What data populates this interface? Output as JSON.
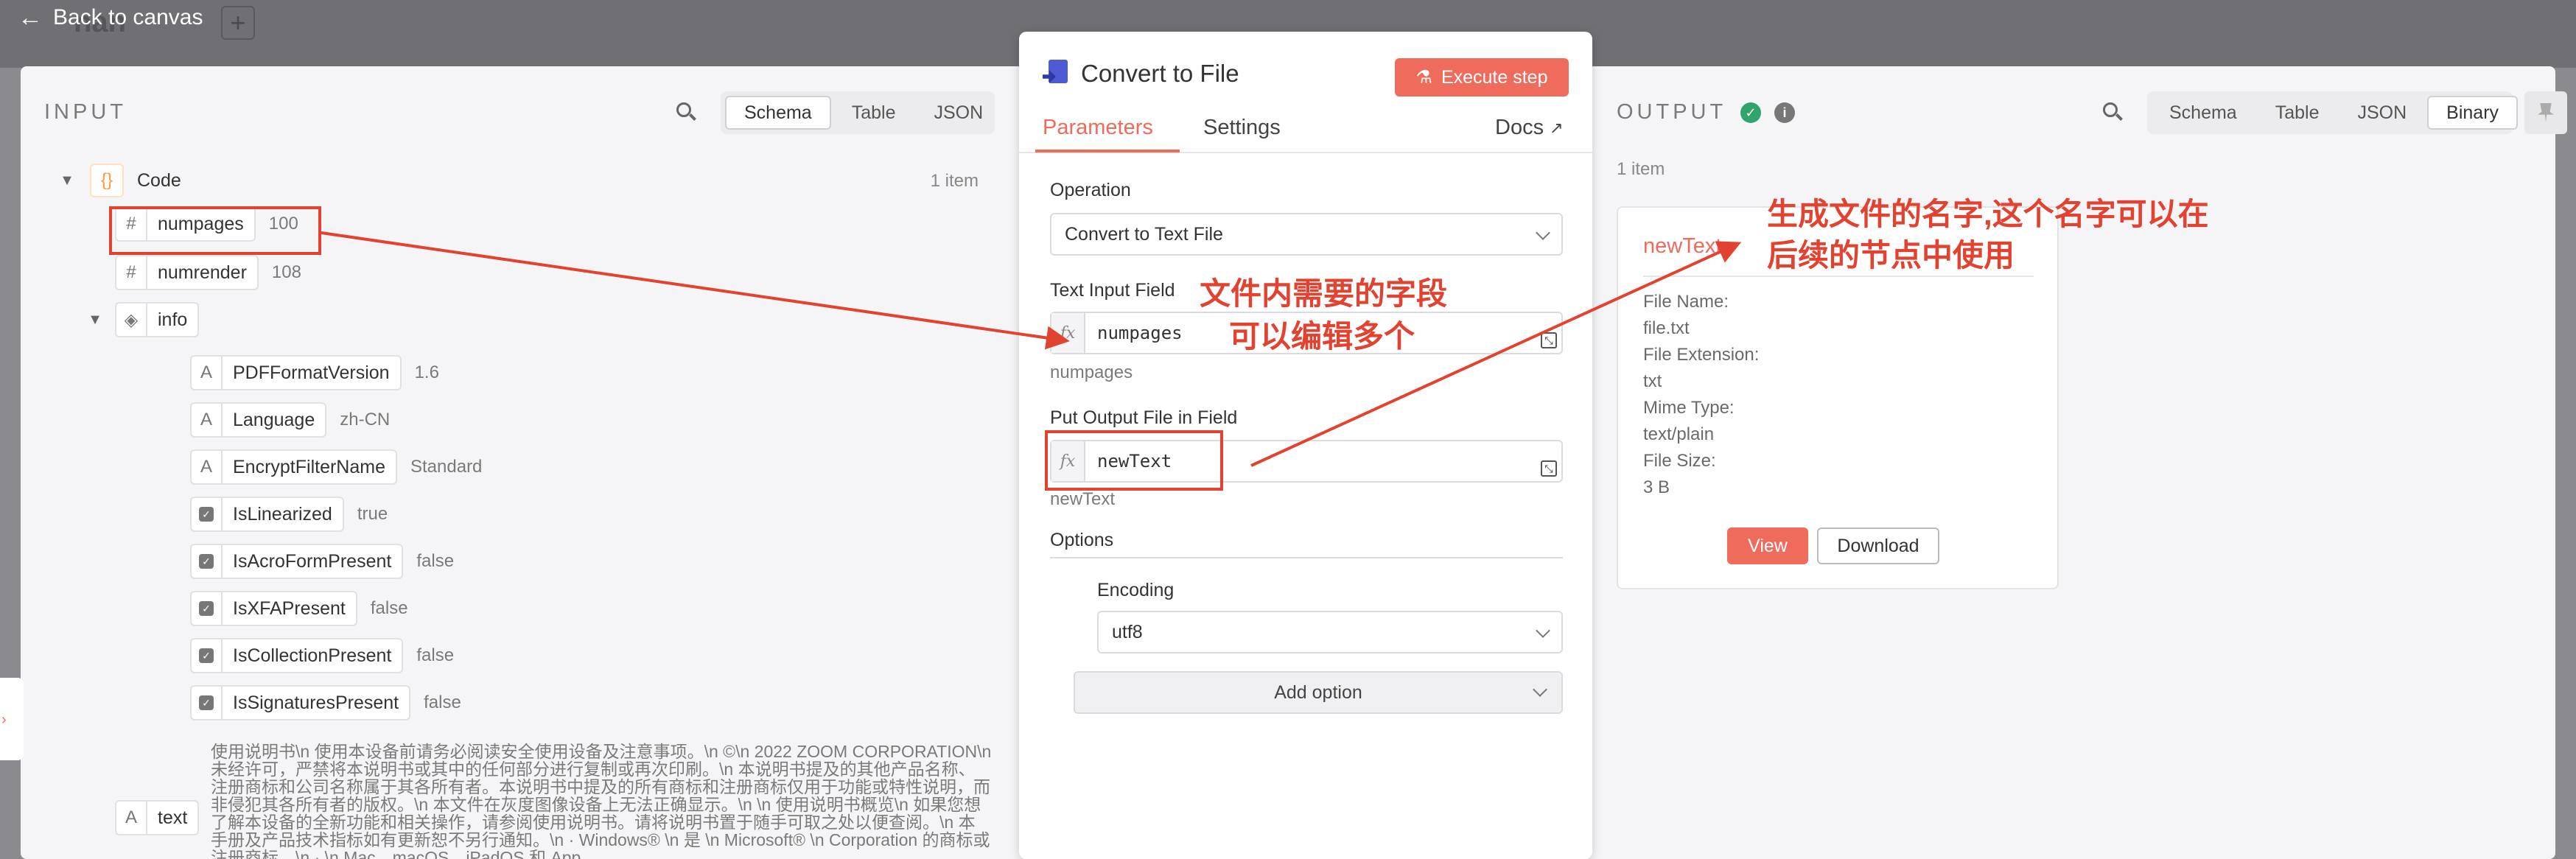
{
  "topbar": {
    "back_label": "Back to canvas",
    "ghost_title": "nan",
    "plus_label": "+"
  },
  "input": {
    "heading": "INPUT",
    "views": [
      "Schema",
      "Table",
      "JSON"
    ],
    "active_view": "Schema",
    "count": "1 item",
    "root": {
      "label": "Code",
      "icon": "curly-braces-icon",
      "glyph": "{}"
    },
    "fields": {
      "numpages": {
        "label": "numpages",
        "value": "100"
      },
      "numrender": {
        "label": "numrender",
        "value": "108"
      },
      "info": {
        "label": "info"
      },
      "text": {
        "label": "text"
      }
    },
    "info_items": [
      {
        "label": "PDFFormatVersion",
        "value": "1.6",
        "type": "A"
      },
      {
        "label": "Language",
        "value": "zh-CN",
        "type": "A"
      },
      {
        "label": "EncryptFilterName",
        "value": "Standard",
        "type": "A"
      },
      {
        "label": "IsLinearized",
        "value": "true",
        "type": "bool"
      },
      {
        "label": "IsAcroFormPresent",
        "value": "false",
        "type": "bool"
      },
      {
        "label": "IsXFAPresent",
        "value": "false",
        "type": "bool"
      },
      {
        "label": "IsCollectionPresent",
        "value": "false",
        "type": "bool"
      },
      {
        "label": "IsSignaturesPresent",
        "value": "false",
        "type": "bool"
      }
    ],
    "text_value": "使用说明书\\n 使用本设备前请务必阅读安全使用设备及注意事项。\\n ©\\n 2022 ZOOM CORPORATION\\n 未经许可，严禁将本说明书或其中的任何部分进行复制或再次印刷。\\n 本说明书提及的其他产品名称、注册商标和公司名称属于其各所有者。本说明书中提及的所有商标和注册商标仅用于功能或特性说明，而非侵犯其各所有者的版权。\\n 本文件在灰度图像设备上无法正确显示。\\n \\n 使用说明书概览\\n 如果您想了解本设备的全新功能和相关操作，请参阅使用说明书。请将说明书置于随手可取之处以便查阅。\\n 本手册及产品技术指标如有更新恕不另行通知。\\n · Windows® \\n 是 \\n Microsoft® \\n Corporation 的商标或注册商标。\\n · \\n Mac、macOS、iPadOS 和 App"
  },
  "node": {
    "title": "Convert to File",
    "execute_label": "Execute step",
    "tabs": [
      "Parameters",
      "Settings"
    ],
    "docs_label": "Docs",
    "operation_label": "Operation",
    "operation_value": "Convert to Text File",
    "text_input_label": "Text Input Field",
    "text_input_value": "numpages",
    "text_input_hint": "numpages",
    "output_field_label": "Put Output File in Field",
    "output_field_value": "newText",
    "output_field_hint": "newText",
    "fx_label": "fx",
    "options_label": "Options",
    "encoding_label": "Encoding",
    "encoding_value": "utf8",
    "add_option_label": "Add option"
  },
  "output": {
    "heading": "OUTPUT",
    "views": [
      "Schema",
      "Table",
      "JSON",
      "Binary"
    ],
    "active_view": "Binary",
    "count": "1 item",
    "file": {
      "name": "newText",
      "file_name_label": "File Name:",
      "file_name": "file.txt",
      "extension_label": "File Extension:",
      "extension": "txt",
      "mime_label": "Mime Type:",
      "mime": "text/plain",
      "size_label": "File Size:",
      "size": "3 B"
    },
    "view_label": "View",
    "download_label": "Download"
  },
  "annotations": {
    "fields_note_1": "文件内需要的字段",
    "fields_note_2": "可以编辑多个",
    "name_note_1": "生成文件的名字,这个名字可以在",
    "name_note_2": "后续的节点中使用",
    "color": "#e24331"
  },
  "colors": {
    "accent": "#ef6b5b",
    "success": "#2fa56b",
    "annotation": "#e24331"
  }
}
